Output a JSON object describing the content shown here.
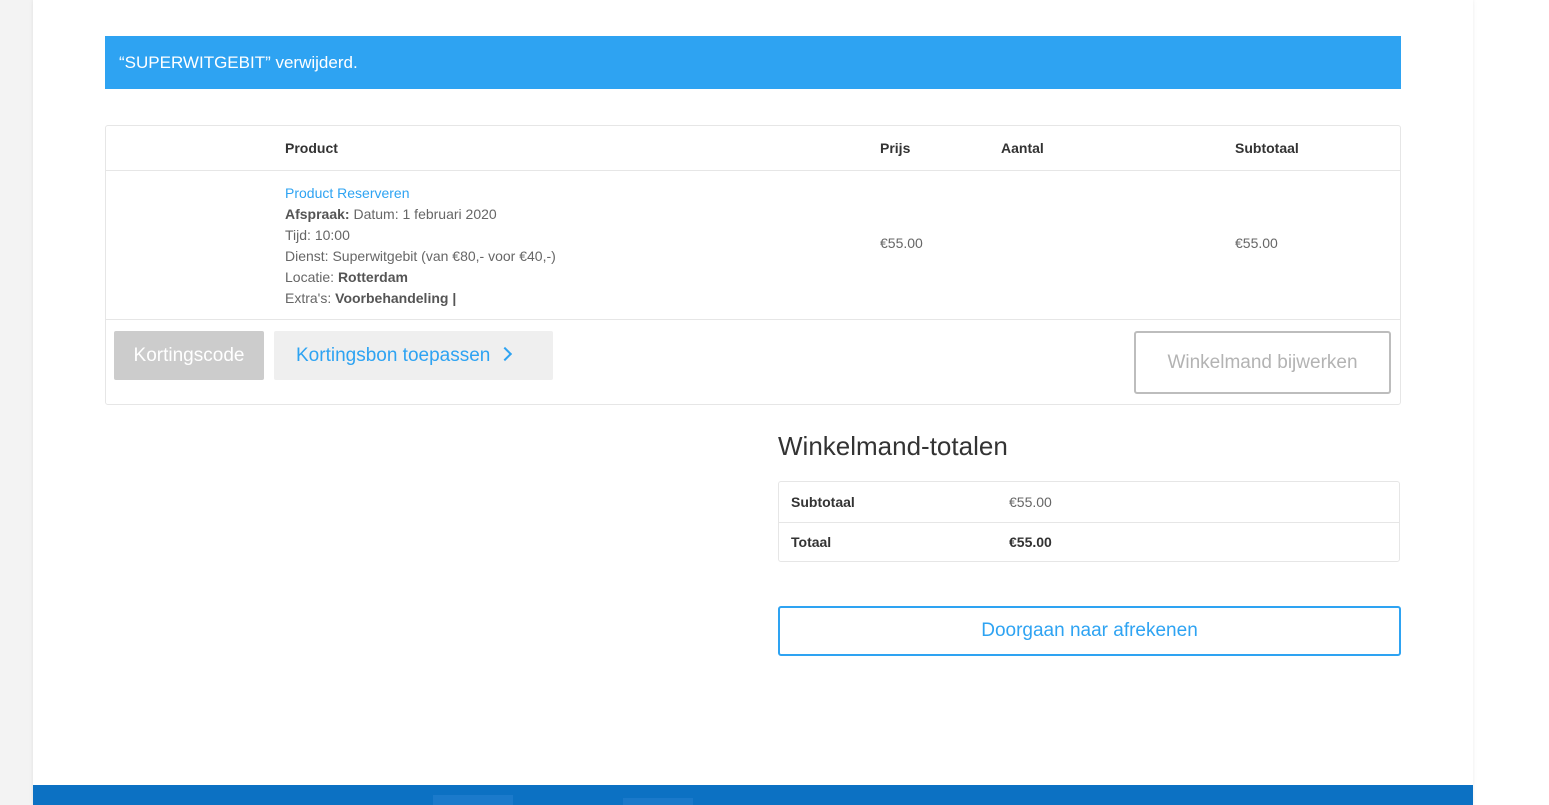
{
  "notice": {
    "message": "“SUPERWITGEBIT” verwijderd."
  },
  "cart": {
    "headers": {
      "product": "Product",
      "price": "Prijs",
      "quantity": "Aantal",
      "subtotal": "Subtotaal"
    },
    "item": {
      "name": "Product Reserveren",
      "appointment_label": "Afspraak:",
      "appointment_value": "Datum: 1 februari 2020",
      "time_line": "Tijd: 10:00",
      "service_line": "Dienst: Superwitgebit (van €80,- voor €40,-)",
      "location_label": "Locatie:",
      "location_value": "Rotterdam",
      "extras_label": "Extra's:",
      "extras_value": "Voorbehandeling |",
      "price": "€55.00",
      "subtotal": "€55.00"
    },
    "actions": {
      "coupon_placeholder": "Kortingscode",
      "apply_coupon": "Kortingsbon toepassen",
      "update_cart": "Winkelmand bijwerken"
    }
  },
  "totals": {
    "title": "Winkelmand-totalen",
    "subtotal_label": "Subtotaal",
    "subtotal_value": "€55.00",
    "total_label": "Totaal",
    "total_value": "€55.00",
    "checkout_label": "Doorgaan naar afrekenen"
  },
  "colors": {
    "accent": "#2ea3f2",
    "footer": "#0c71c3"
  }
}
